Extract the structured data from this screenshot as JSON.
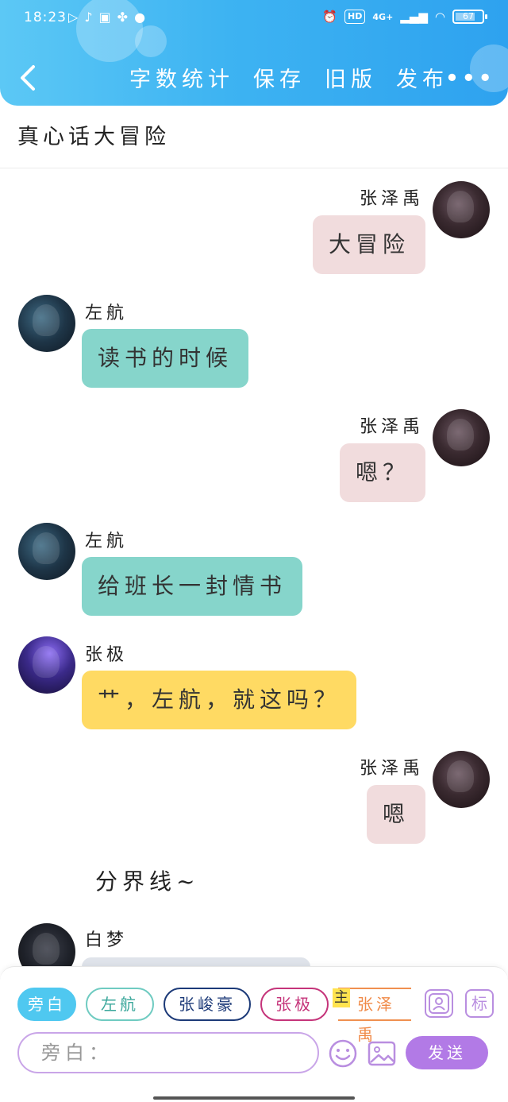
{
  "status_bar": {
    "time": "18:23",
    "network": "4G+",
    "hd": "HD",
    "battery": "67"
  },
  "header": {
    "actions": [
      "字数统计",
      "保存",
      "旧版",
      "发布"
    ],
    "more": "•••"
  },
  "story_title": "真心话大冒险",
  "messages": [
    {
      "speaker": "张泽禹",
      "text": "大冒险",
      "side": "right",
      "color": "#f1dcdd"
    },
    {
      "speaker": "左航",
      "text": "读书的时候",
      "side": "left",
      "color": "#86d5cb"
    },
    {
      "speaker": "张泽禹",
      "text": "嗯？",
      "side": "right",
      "color": "#f1dcdd"
    },
    {
      "speaker": "左航",
      "text": "给班长一封情书",
      "side": "left",
      "color": "#86d5cb"
    },
    {
      "speaker": "张极",
      "text": "艹，左航，就这吗？",
      "side": "left",
      "color": "#ffda63"
    },
    {
      "speaker": "张泽禹",
      "text": "嗯",
      "side": "right",
      "color": "#f1dcdd"
    }
  ],
  "divider": "分界线~",
  "partial_message": {
    "speaker": "白梦"
  },
  "characters": {
    "narrator": "旁白",
    "zuohang": "左航",
    "zhangjunhao": "张峻豪",
    "zhangji": "张极",
    "zhangzeyu": "张泽禹",
    "main_tag": "主"
  },
  "tools": {
    "role_icon": "person-card-icon",
    "tag_label": "标"
  },
  "composer": {
    "placeholder": "旁白：",
    "send_label": "发送"
  }
}
